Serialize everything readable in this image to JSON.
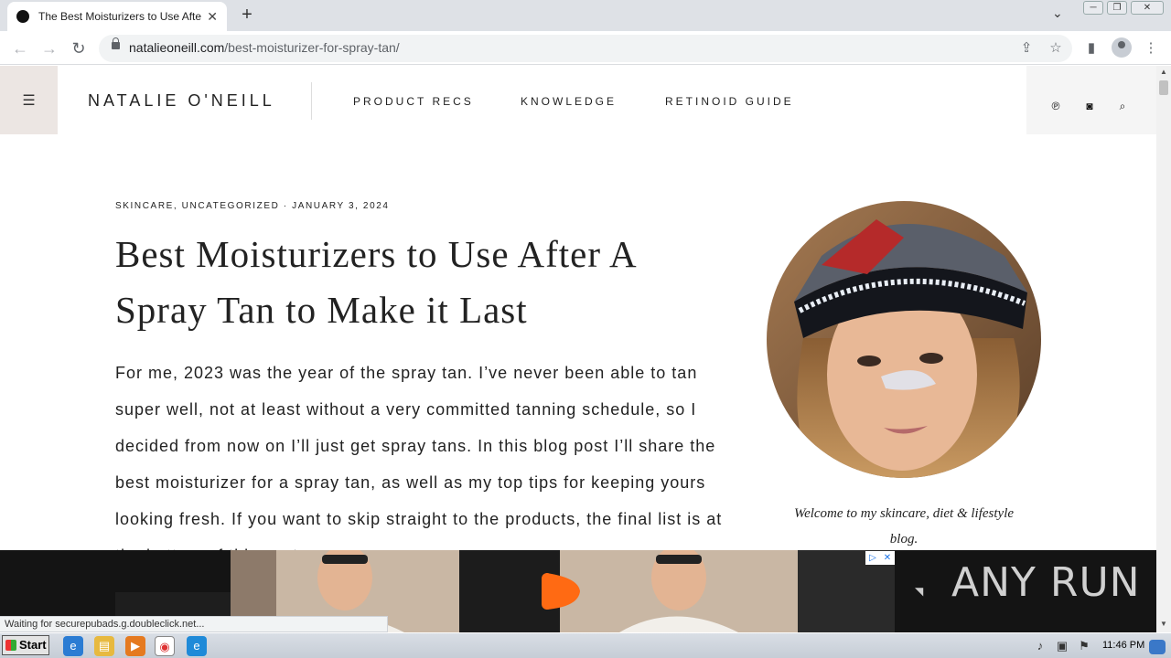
{
  "browser": {
    "tab_title": "The Best Moisturizers to Use After A Spray Tan to Make it Last",
    "tab_close": "✕",
    "new_tab": "+",
    "url_domain": "natalieoneill.com",
    "url_path": "/best-moisturizer-for-spray-tan/",
    "status": "Waiting for securepubads.g.doubleclick.net..."
  },
  "site": {
    "brand": "NATALIE O'NEILL",
    "nav": [
      "PRODUCT RECS",
      "KNOWLEDGE",
      "RETINOID GUIDE"
    ]
  },
  "article": {
    "meta": "SKINCARE, UNCATEGORIZED · JANUARY 3, 2024",
    "title": "Best Moisturizers to Use After A Spray Tan to Make it Last",
    "body": "For me, 2023 was the year of the spray tan. I’ve never been able to tan super well, not at least without a very committed tanning schedule, so I decided from now on I’ll just get spray tans. In this blog post I’ll share the best moisturizer for a spray tan, as well as my top tips for keeping yours looking fresh. If you want to skip straight to the products, the final list is at the bottom of this post."
  },
  "sidebar": {
    "welcome": "Welcome to my skincare, diet & lifestyle blog."
  },
  "ad": {
    "watermark": "ANY RUN"
  },
  "taskbar": {
    "start": "Start",
    "clock": "11:46 PM"
  },
  "colors": {
    "menu_bg": "#ece6e3",
    "ad_accent": "#ff6a13"
  }
}
